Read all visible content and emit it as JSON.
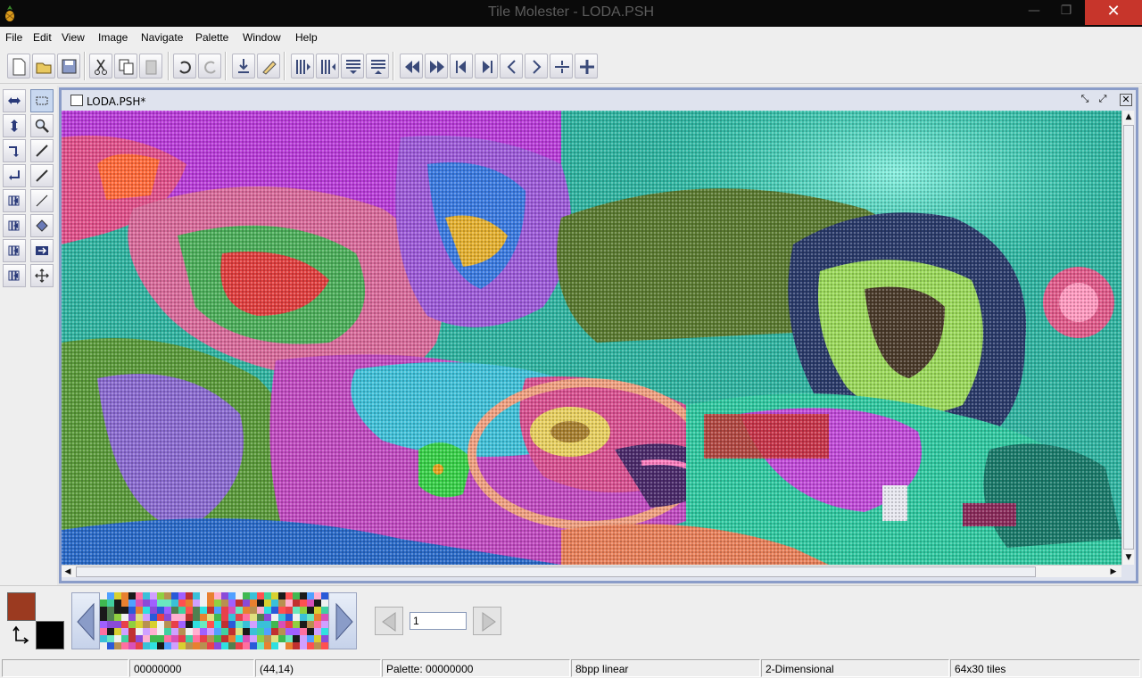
{
  "window": {
    "title": "Tile Molester - LODA.PSH",
    "minimize_glyph": "—",
    "restore_glyph": "❐",
    "close_glyph": "✕"
  },
  "menu": [
    "File",
    "Edit",
    "View",
    "Image",
    "Navigate",
    "Palette",
    "Window",
    "Help"
  ],
  "toolbar": {
    "buttons": [
      "new-icon",
      "open-icon",
      "save-icon",
      "cut-icon",
      "copy-icon",
      "paste-icon",
      "undo-icon",
      "redo-icon",
      "go-to-icon",
      "bookmark-icon",
      "decrease-width-icon",
      "increase-width-icon",
      "decrease-height-icon",
      "increase-height-icon",
      "page-back-icon",
      "page-forward-icon",
      "row-back-icon",
      "row-forward-icon",
      "tile-back-icon",
      "tile-forward-icon",
      "byte-back-icon",
      "byte-forward-icon"
    ]
  },
  "tools": [
    "move-left-right",
    "selection",
    "move-up-down",
    "zoom",
    "rotate",
    "dropper",
    "flip",
    "brush",
    "shift-left",
    "line",
    "shift-right",
    "fill",
    "shift-up",
    "replace",
    "shift-down",
    "mover"
  ],
  "document": {
    "title": "LODA.PSH*",
    "iconify_glyph": "⤡",
    "maximize_glyph": "⤢",
    "close_glyph": "✕"
  },
  "colors": {
    "foreground": "#9b3a20",
    "background": "#000000",
    "accent": "#8a9cc8"
  },
  "page_navigator": {
    "value": "1"
  },
  "status": {
    "offset": "00000000",
    "coords": "(44,14)",
    "palette": "Palette: 00000000",
    "codec": "8bpp linear",
    "mode": "2-Dimensional",
    "size": "64x30 tiles"
  }
}
